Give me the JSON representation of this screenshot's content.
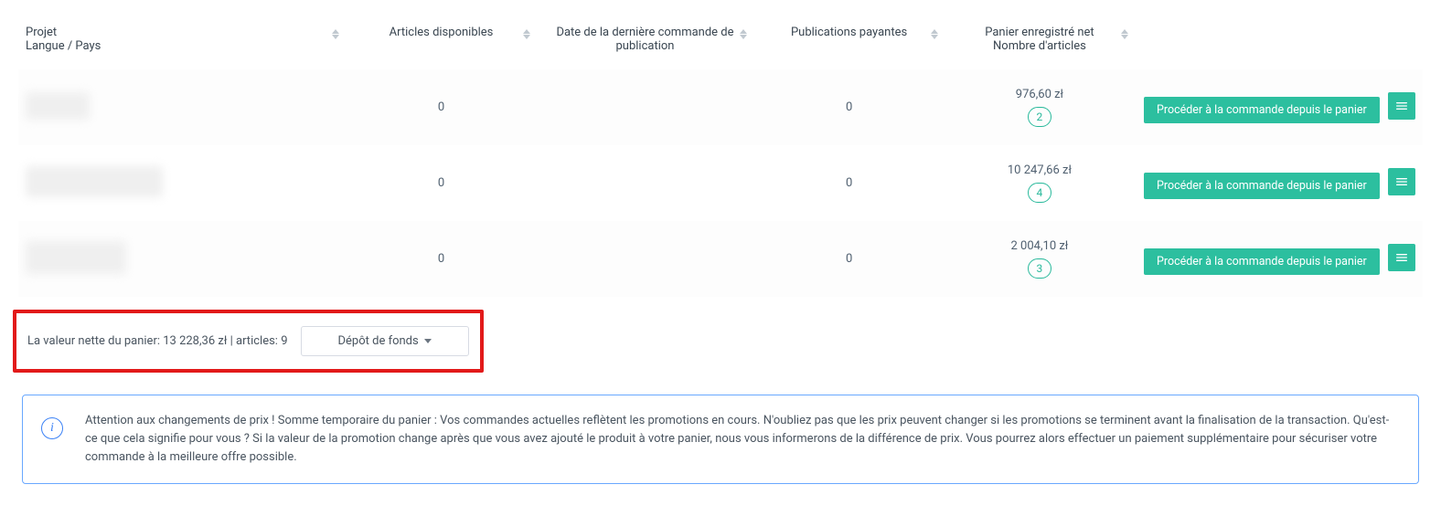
{
  "table": {
    "headers": {
      "project_label": "Projet",
      "project_sub": "Langue / Pays",
      "articles_available": "Articles disponibles",
      "last_order_date": "Date de la dernière commande de publication",
      "paid_publications": "Publications payantes",
      "cart_net_label": "Panier enregistré net",
      "cart_net_sub": "Nombre d'articles"
    },
    "rows": [
      {
        "articles": "0",
        "last_date": "",
        "paid": "0",
        "price": "976,60 zł",
        "count": "2"
      },
      {
        "articles": "0",
        "last_date": "",
        "paid": "0",
        "price": "10 247,66 zł",
        "count": "4"
      },
      {
        "articles": "0",
        "last_date": "",
        "paid": "0",
        "price": "2 004,10 zł",
        "count": "3"
      }
    ]
  },
  "actions": {
    "proceed_label": "Procéder à la commande depuis le panier"
  },
  "summary": {
    "net_label": "La valeur nette du panier:",
    "net_value": "13 228,36 zł",
    "sep": "|",
    "articles_label": "articles:",
    "articles_value": "9",
    "deposit_label": "Dépôt de fonds"
  },
  "alert": {
    "text": "Attention aux changements de prix ! Somme temporaire du panier : Vos commandes actuelles reflètent les promotions en cours. N'oubliez pas que les prix peuvent changer si les promotions se terminent avant la finalisation de la transaction. Qu'est-ce que cela signifie pour vous ? Si la valeur de la promotion change après que vous avez ajouté le produit à votre panier, nous vous informerons de la différence de prix. Vous pourrez alors effectuer un paiement supplémentaire pour sécuriser votre commande à la meilleure offre possible."
  }
}
